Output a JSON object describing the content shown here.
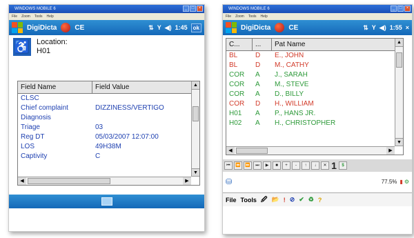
{
  "emulator": {
    "title": "WINDOWS MOBILE 6",
    "menu": [
      "File",
      "Zoom",
      "Tools",
      "Help"
    ]
  },
  "left_screen": {
    "taskbar": {
      "app_title": "DigiDicta",
      "ce_label": "CE",
      "time": "1:45",
      "ok_label": "ok"
    },
    "location": {
      "label": "Location:",
      "value": "H01"
    },
    "grid": {
      "headers": [
        "Field Name",
        "Field Value"
      ],
      "rows": [
        {
          "field": "CLSC",
          "value": ""
        },
        {
          "field": "Chief complaint",
          "value": "DIZZINESS/VERTIGO"
        },
        {
          "field": "Diagnosis",
          "value": ""
        },
        {
          "field": "Triage",
          "value": "03"
        },
        {
          "field": "Reg DT",
          "value": "05/03/2007 12:07:00"
        },
        {
          "field": "LOS",
          "value": "49H38M"
        },
        {
          "field": "Captivity",
          "value": "C"
        }
      ]
    }
  },
  "right_screen": {
    "taskbar": {
      "app_title": "DigiDicta",
      "ce_label": "CE",
      "time": "1:55",
      "close_label": "×"
    },
    "grid": {
      "headers": [
        "C...",
        "...",
        "Pat Name"
      ],
      "rows": [
        {
          "c": "BL",
          "s": "D",
          "name": "E., JOHN",
          "color": "#d23b2a"
        },
        {
          "c": "BL",
          "s": "D",
          "name": "M., CATHY",
          "color": "#d23b2a"
        },
        {
          "c": "COR",
          "s": "A",
          "name": "J., SARAH",
          "color": "#2e9a3a"
        },
        {
          "c": "COR",
          "s": "A",
          "name": "M., STEVE",
          "color": "#2e9a3a"
        },
        {
          "c": "COR",
          "s": "A",
          "name": "D., BILLY",
          "color": "#2e9a3a"
        },
        {
          "c": "COR",
          "s": "D",
          "name": "H., WILLIAM",
          "color": "#d23b2a"
        },
        {
          "c": "H01",
          "s": "A",
          "name": "P., HANS JR.",
          "color": "#2e9a3a"
        },
        {
          "c": "H02",
          "s": "A",
          "name": "H., CHRISTOPHER",
          "color": "#2e9a3a"
        }
      ]
    },
    "nav": {
      "page_number": "1",
      "dollar": "$"
    },
    "status": {
      "zoom": "77.5%"
    },
    "toolbar": {
      "file_label": "File",
      "tools_label": "Tools"
    }
  },
  "icons": {
    "start": "windows-flag-icon",
    "signal": "antenna-icon",
    "volume": "speaker-icon",
    "wheelchair": "wheelchair-icon",
    "keyboard": "keyboard-icon"
  }
}
